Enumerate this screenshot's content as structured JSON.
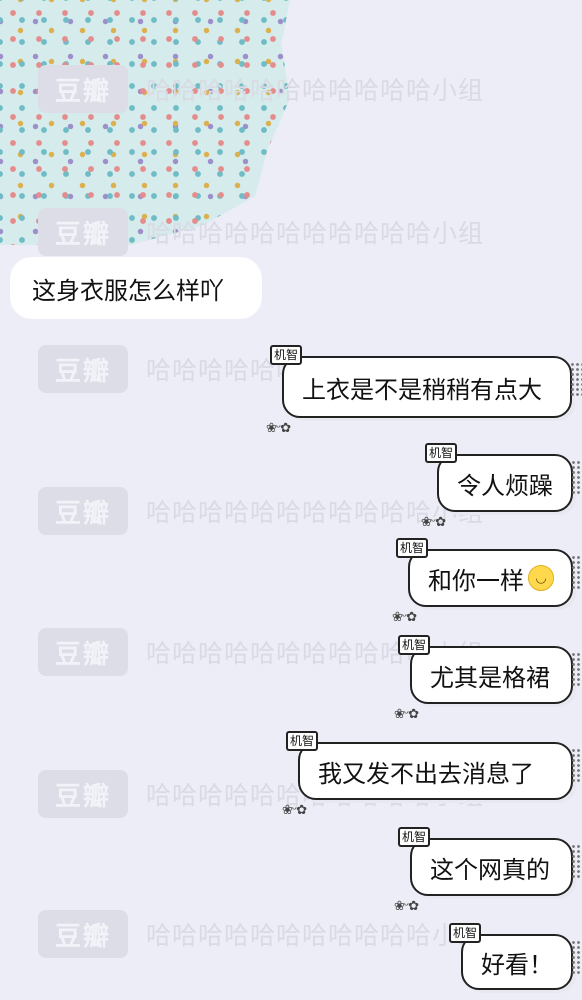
{
  "watermark": {
    "logo": "豆瓣",
    "text": "哈哈哈哈哈哈哈哈哈哈哈小组"
  },
  "messages": {
    "incoming": {
      "text": "这身衣服怎么样吖"
    },
    "outgoing": [
      {
        "tag": "机智",
        "text": "上衣是不是稍稍有点大"
      },
      {
        "tag": "机智",
        "text": "令人烦躁"
      },
      {
        "tag": "机智",
        "text": "和你一样"
      },
      {
        "tag": "机智",
        "text": "尤其是格裙"
      },
      {
        "tag": "机智",
        "text": "我又发不出去消息了"
      },
      {
        "tag": "机智",
        "text": "这个网真的"
      },
      {
        "tag": "机智",
        "text": "好看！"
      }
    ]
  },
  "icons": {
    "polka_pattern": "polka-dot-image",
    "emoji": "slightly-smiling-face-icon"
  },
  "colors": {
    "background": "#ecedf6",
    "bubble": "#ffffff",
    "border": "#222222"
  }
}
